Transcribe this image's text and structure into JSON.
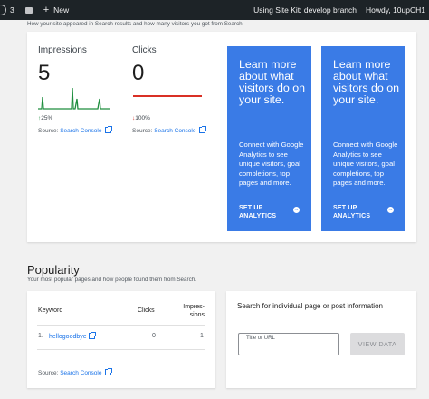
{
  "adminbar": {
    "comments_count": "3",
    "new_label": "New",
    "site_kit_label": "Using Site Kit: develop branch",
    "howdy_label": "Howdy, 10upCH1"
  },
  "search": {
    "subtitle": "How your site appeared in Search results and how many visitors you got from Search.",
    "impressions": {
      "label": "Impressions",
      "value": "5",
      "change": "25%",
      "change_direction": "up",
      "source_prefix": "Source:",
      "source_link": "Search Console"
    },
    "clicks": {
      "label": "Clicks",
      "value": "0",
      "change": "100%",
      "change_direction": "down",
      "source_prefix": "Source:",
      "source_link": "Search Console"
    },
    "cta1": {
      "title": "Learn more about what visitors do on your site.",
      "body": "Connect with Google Analytics to see unique visitors, goal completions, top pages and more.",
      "link_line1": "SET UP",
      "link_line2": "ANALYTICS"
    },
    "cta2": {
      "title": "Learn more about what visitors do on your site.",
      "body": "Connect with Google Analytics to see unique visitors, goal completions, top pages and more.",
      "link_line1": "SET UP",
      "link_line2": "ANALYTICS"
    },
    "colors": {
      "up": "#1e8e3e",
      "down": "#d93025",
      "cta": "#3a7be6",
      "link": "#1a73e8"
    }
  },
  "popularity": {
    "title": "Popularity",
    "subtitle": "Your most popular pages and how people found them from Search.",
    "table": {
      "headers": {
        "keyword": "Keyword",
        "clicks": "Clicks",
        "impressions_line1": "Impres-",
        "impressions_line2": "sions"
      },
      "rows": [
        {
          "index": "1.",
          "keyword": "hellogoodbye",
          "clicks": "0",
          "impressions": "1"
        }
      ],
      "source_prefix": "Source:",
      "source_link": "Search Console"
    },
    "search_card": {
      "title": "Search for individual page or post information",
      "field_label": "Title or URL",
      "button_label": "VIEW DATA"
    }
  }
}
